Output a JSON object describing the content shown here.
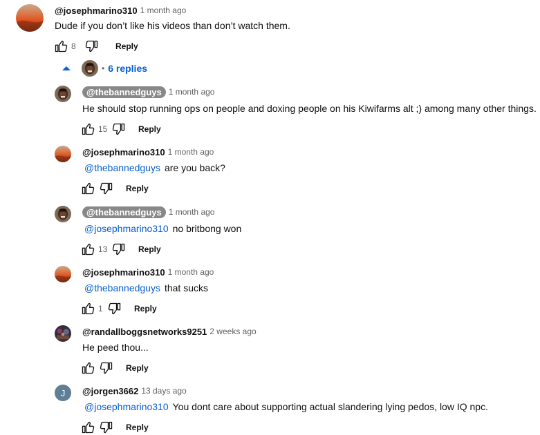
{
  "colors": {
    "link": "#065fd4",
    "pill": "#888888",
    "text": "#0f0f0f",
    "meta": "#606060"
  },
  "icons": {
    "like": "thumbs-up-icon",
    "dislike": "thumbs-down-icon",
    "collapse": "caret-up-icon"
  },
  "top_comment": {
    "author": "@josephmarino310",
    "time": "1 month ago",
    "text": "Dude if you don’t like his videos than don’t watch them.",
    "likes": "8",
    "reply_label": "Reply"
  },
  "replies_toggle": {
    "label": "6 replies"
  },
  "replies": [
    {
      "author": "@thebannedguys",
      "time": "1 month ago",
      "mention": "",
      "text": "He should stop running ops on people and doxing people on his Kiwifarms alt ;) among many other things.",
      "likes": "15",
      "reply_label": "Reply"
    },
    {
      "author": "@josephmarino310",
      "time": "1 month ago",
      "mention": "@thebannedguys",
      "text": "are you back?",
      "likes": "",
      "reply_label": "Reply"
    },
    {
      "author": "@thebannedguys",
      "time": "1 month ago",
      "mention": "@josephmarino310",
      "text": "no britbong won",
      "likes": "13",
      "reply_label": "Reply"
    },
    {
      "author": "@josephmarino310",
      "time": "1 month ago",
      "mention": "@thebannedguys",
      "text": "that sucks",
      "likes": "1",
      "reply_label": "Reply"
    },
    {
      "author": "@randallboggsnetworks9251",
      "time": "2 weeks ago",
      "mention": "",
      "text": "He peed thou...",
      "likes": "",
      "reply_label": "Reply"
    },
    {
      "author": "@jorgen3662",
      "time": "13 days ago",
      "avatar_letter": "J",
      "mention": "@josephmarino310",
      "text": "You dont care about supporting actual slandering lying pedos, low IQ npc.",
      "likes": "",
      "reply_label": "Reply"
    }
  ]
}
